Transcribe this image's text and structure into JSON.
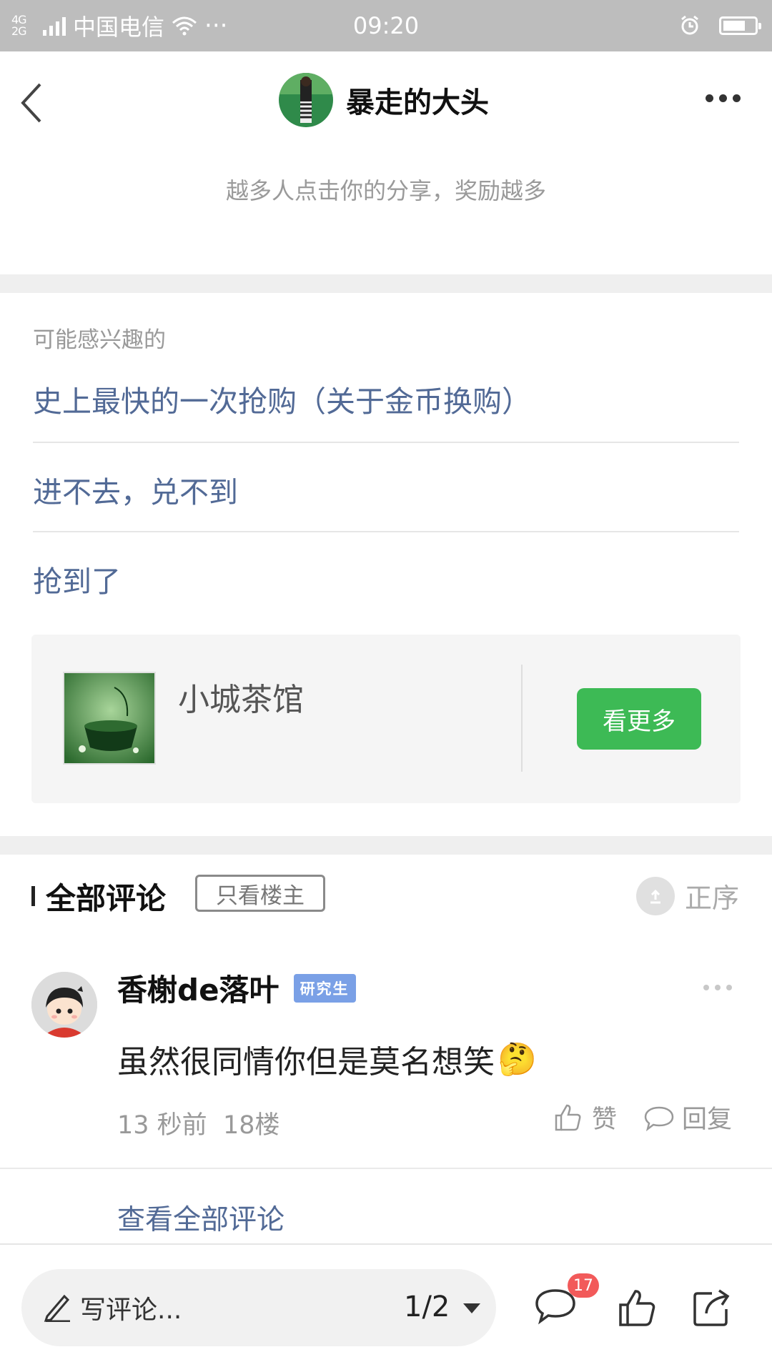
{
  "status_bar": {
    "network": "4G 2G",
    "carrier": "中国电信",
    "time": "09:20",
    "dots": "···"
  },
  "header": {
    "author_name": "暴走的大头",
    "share_tip": "越多人点击你的分享，奖励越多"
  },
  "related": {
    "title": "可能感兴趣的",
    "items": [
      "史上最快的一次抢购（关于金币换购）",
      "进不去，兑不到",
      "抢到了"
    ]
  },
  "account": {
    "name": "小城茶馆",
    "see_more": "看更多"
  },
  "comments": {
    "title": "全部评论",
    "op_only": "只看楼主",
    "sort_label": "正序",
    "items": [
      {
        "user": "香榭de落叶",
        "badge": "研究生",
        "text": "虽然很同情你但是莫名想笑",
        "emoji": "🤔",
        "time": "13 秒前",
        "floor": "18楼",
        "like_label": "赞",
        "reply_label": "回复"
      }
    ],
    "view_all": "查看全部评论"
  },
  "toolbar": {
    "write_placeholder": "写评论...",
    "page_indicator": "1/2",
    "comment_count": "17"
  },
  "colors": {
    "link_blue": "#526a96",
    "green_button": "#3dba55",
    "badge_red": "#f25a5a",
    "badge_blue": "#7aa0e6"
  }
}
